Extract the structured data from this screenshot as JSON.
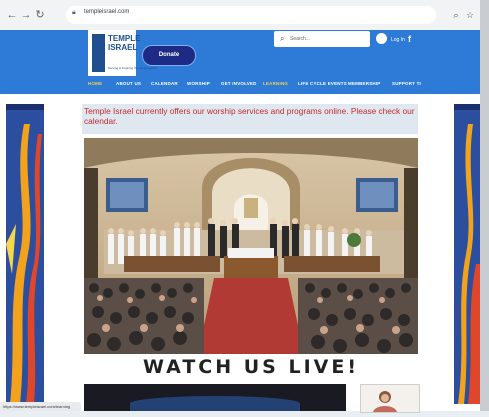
{
  "browser": {
    "url": "templeisrael.com"
  },
  "site": {
    "logo_line1": "TEMPLE",
    "logo_line2": "ISRAEL",
    "logo_tagline": "Serving & Inspiring the Congregation",
    "donate_label": "Donate",
    "search_placeholder": "Search...",
    "login_label": "Log In",
    "social": "f",
    "nav": [
      "HOME",
      "ABOUT US",
      "CALENDAR",
      "WORSHIP",
      "GET INVOLVED",
      "LEARNING",
      "LIFE CYCLE EVENTS",
      "MEMBERSHIP",
      "SUPPORT TI"
    ]
  },
  "content": {
    "announcement": "Temple Israel currently offers our worship services and programs online. Please check our calendar.",
    "headline": "WATCH US LIVE!"
  },
  "status_bar": {
    "link": "https://www.templeisrael.com/learning"
  },
  "colors": {
    "header_blue": "#2d7bd6",
    "donate_navy": "#1d2b87",
    "nav_active": "#f2d14c",
    "announcement_red": "#c42b2b"
  }
}
